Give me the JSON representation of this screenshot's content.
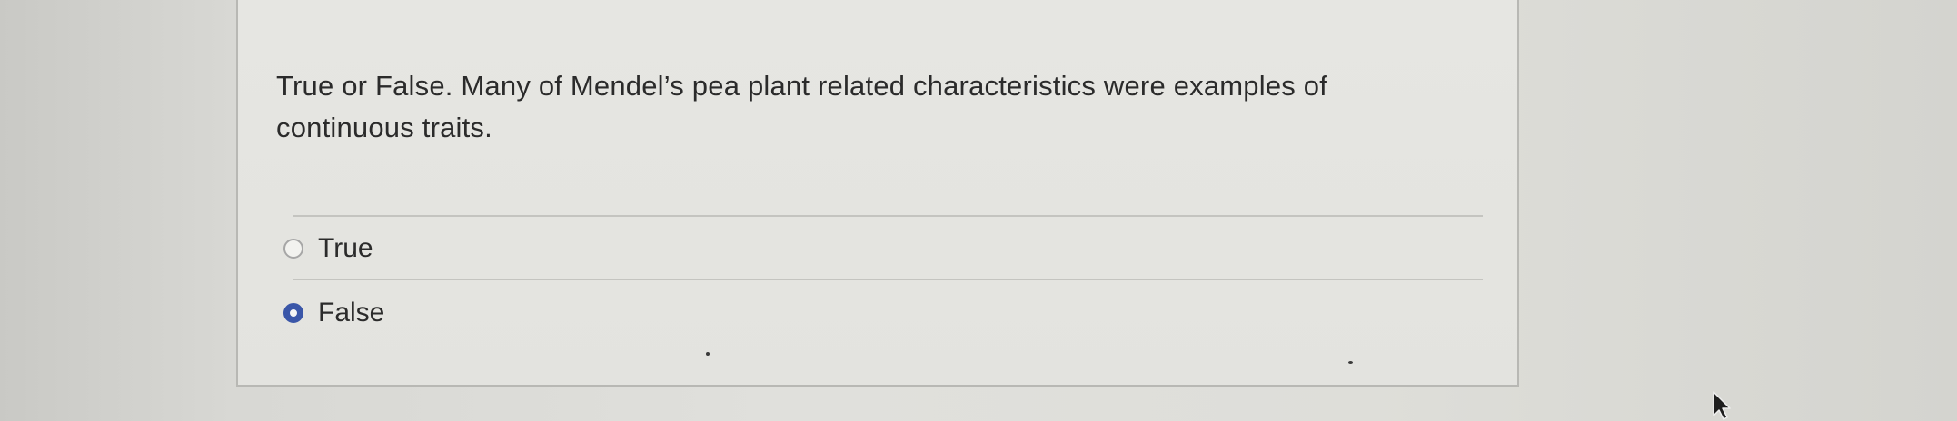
{
  "question": {
    "text": "True or False.  Many of Mendel’s pea plant related characteristics were examples of continuous traits."
  },
  "options": [
    {
      "label": "True",
      "selected": false
    },
    {
      "label": "False",
      "selected": true
    }
  ],
  "colors": {
    "selected_radio": "#3a56a8",
    "text": "#2b2b2b",
    "divider": "#c4c4c0"
  },
  "icons": {
    "cursor": "mouse-pointer-icon"
  }
}
